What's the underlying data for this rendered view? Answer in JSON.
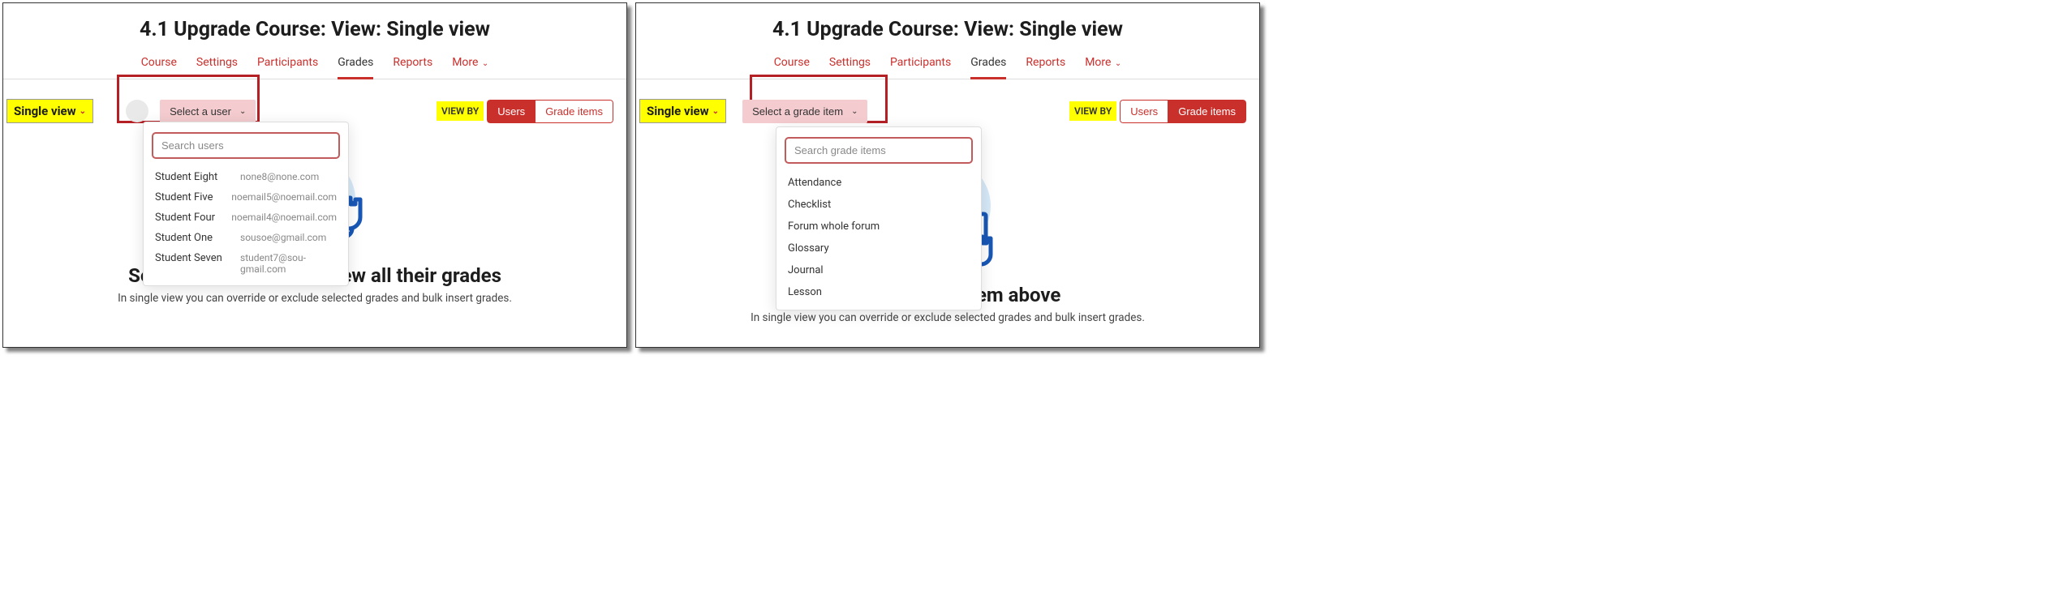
{
  "page_title": "4.1 Upgrade Course: View: Single view",
  "nav": {
    "items": [
      "Course",
      "Settings",
      "Participants",
      "Grades",
      "Reports"
    ],
    "more": "More",
    "active_index": 3
  },
  "mode_badge": "Single view",
  "viewby_label": "VIEW BY",
  "toggle": {
    "users": "Users",
    "grade_items": "Grade items"
  },
  "left": {
    "select_label": "Select a user",
    "search_placeholder": "Search users",
    "users": [
      {
        "name": "Student Eight",
        "email": "none8@none.com"
      },
      {
        "name": "Student Five",
        "email": "noemail5@noemail.com"
      },
      {
        "name": "Student Four",
        "email": "noemail4@noemail.com"
      },
      {
        "name": "Student One",
        "email": "sousoe@gmail.com"
      },
      {
        "name": "Student Seven",
        "email": "student7@sou-gmail.com"
      }
    ],
    "hero_title": "Select a user above to view all their grades",
    "hero_sub": "In single view you can override or exclude selected grades and bulk insert grades."
  },
  "right": {
    "select_label": "Select a grade item",
    "search_placeholder": "Search grade items",
    "items": [
      "Attendance",
      "Checklist",
      "Forum whole forum",
      "Glossary",
      "Journal",
      "Lesson"
    ],
    "hero_title": "Select a grade item above",
    "hero_sub": "In single view you can override or exclude selected grades and bulk insert grades."
  }
}
